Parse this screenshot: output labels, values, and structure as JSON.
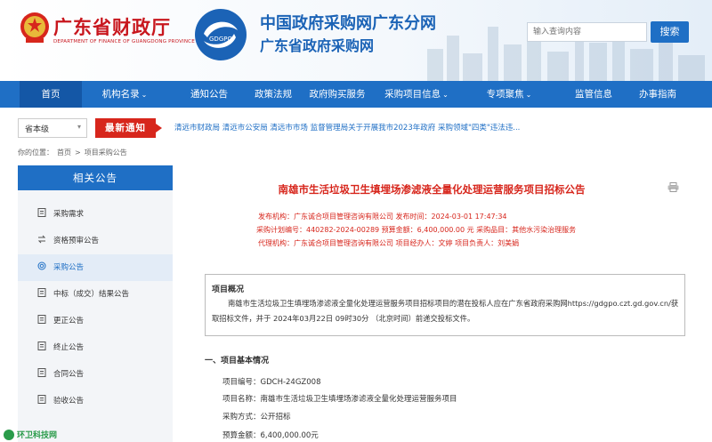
{
  "header": {
    "finance_cn": "广东省财政厅",
    "finance_en": "DEPARTMENT OF FINANCE OF GUANGDONG PROVINCE",
    "logo_text": "GDGPO",
    "portal_title": "中国政府采购网广东分网",
    "portal_sub": "广东省政府采购网",
    "search_placeholder": "输入查询内容",
    "search_button": "搜索"
  },
  "nav": {
    "items": [
      "首页",
      "机构名录",
      "通知公告",
      "政策法规",
      "政府购买服务",
      "采购项目信息",
      "专项聚焦",
      "监管信息",
      "办事指南"
    ]
  },
  "notice": {
    "region": "省本级",
    "label": "最新通知",
    "text": "清远市财政局 清远市公安局 清远市市场 监督管理局关于开展我市2023年政府 采购领域\"四类\"违法违..."
  },
  "breadcrumb": {
    "prefix": "你的位置：",
    "home": "首页",
    "sep": ">",
    "current": "项目采购公告"
  },
  "sidebar": {
    "title": "相关公告",
    "items": [
      {
        "label": "采购需求",
        "icon": "document-icon"
      },
      {
        "label": "资格预审公告",
        "icon": "exchange-icon"
      },
      {
        "label": "采购公告",
        "icon": "target-icon"
      },
      {
        "label": "中标（成交）结果公告",
        "icon": "document-icon"
      },
      {
        "label": "更正公告",
        "icon": "document-icon"
      },
      {
        "label": "终止公告",
        "icon": "document-icon"
      },
      {
        "label": "合同公告",
        "icon": "document-icon"
      },
      {
        "label": "验收公告",
        "icon": "document-icon"
      }
    ]
  },
  "doc": {
    "title": "南雄市生活垃圾卫生填埋场渗滤液全量化处理运营服务项目招标公告",
    "meta": [
      "发布机构：广东诚合项目管理咨询有限公司      发布时间：2024-03-01 17:47:34",
      "采购计划编号：440282-2024-00289      预算金额：6,400,000.00 元      采购品目：其他水污染治理服务",
      "代理机构：广东诚合项目管理咨询有限公司      项目经办人：文婷      项目负责人：刘美娟"
    ],
    "overview_title": "项目概况",
    "overview_text": "南雄市生活垃圾卫生填埋场渗滤液全量化处理运营服务项目招标项目的潜在投标人应在广东省政府采购网https://gdgpo.czt.gd.gov.cn/获取招标文件，并于 2024年03月22日 09时30分 （北京时间）前递交投标文件。",
    "section_title": "一、项目基本情况",
    "info": [
      "项目编号：GDCH-24GZ008",
      "项目名称：南雄市生活垃圾卫生填埋场渗滤液全量化处理运营服务项目",
      "采购方式：公开招标",
      "预算金额：6,400,000.00元"
    ]
  },
  "watermark": "环卫科技网"
}
